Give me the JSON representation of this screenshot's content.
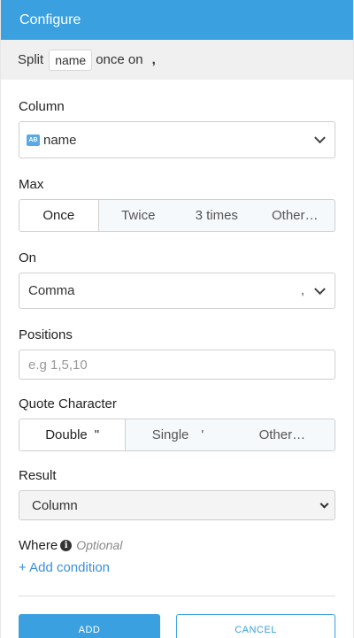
{
  "header": {
    "title": "Configure"
  },
  "summary": {
    "prefix": "Split",
    "column_chip": "name",
    "middle": "once on",
    "separator": ","
  },
  "column": {
    "label": "Column",
    "type_badge": "AB",
    "value": "name"
  },
  "max": {
    "label": "Max",
    "options": [
      "Once",
      "Twice",
      "3 times",
      "Other…"
    ],
    "selected": "Once"
  },
  "on": {
    "label": "On",
    "value": "Comma",
    "suffix": ","
  },
  "positions": {
    "label": "Positions",
    "placeholder": "e.g 1,5,10",
    "value": ""
  },
  "quote": {
    "label": "Quote Character",
    "options": [
      {
        "label": "Double",
        "symbol": "\""
      },
      {
        "label": "Single",
        "symbol": "'"
      },
      {
        "label": "Other…",
        "symbol": ""
      }
    ],
    "selected": "Double"
  },
  "result": {
    "label": "Result",
    "value": "Column"
  },
  "where": {
    "label": "Where",
    "optional": "Optional",
    "add_condition": "+ Add condition"
  },
  "actions": {
    "add": "ADD",
    "cancel": "CANCEL"
  },
  "colors": {
    "accent": "#3aa0e0",
    "link": "#3a8fd8"
  },
  "icons": {
    "info": "info-icon",
    "dropdown": "chevron-down-icon",
    "column_type": "string-type-icon"
  }
}
